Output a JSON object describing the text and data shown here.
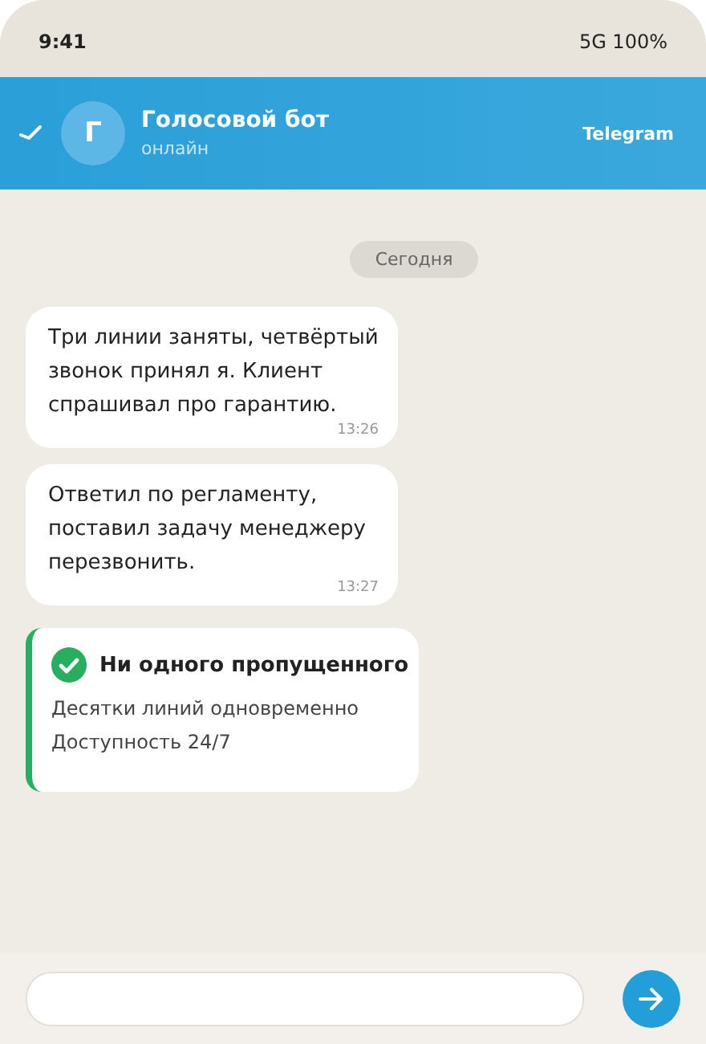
{
  "status_bar": {
    "time": "9:41",
    "indicators": "5G 100%"
  },
  "header": {
    "avatar": "Г",
    "title": "Голосовой бот",
    "subtitle": "онлайн",
    "badge": "Telegram"
  },
  "date_chip": "Сегодня",
  "messages": [
    {
      "kind": "text",
      "text": "Три линии заняты, четвёртый звонок принял я. Клиент спрашивал про гарантию.",
      "time": "13:26"
    },
    {
      "kind": "text",
      "text": "Ответил по регламенту, поставил задачу менеджеру перезвонить.",
      "time": "13:27"
    },
    {
      "kind": "card",
      "title": "Ни одного пропущенного",
      "lines": [
        "Десятки линий одновременно",
        "Доступность 24/7"
      ]
    }
  ]
}
